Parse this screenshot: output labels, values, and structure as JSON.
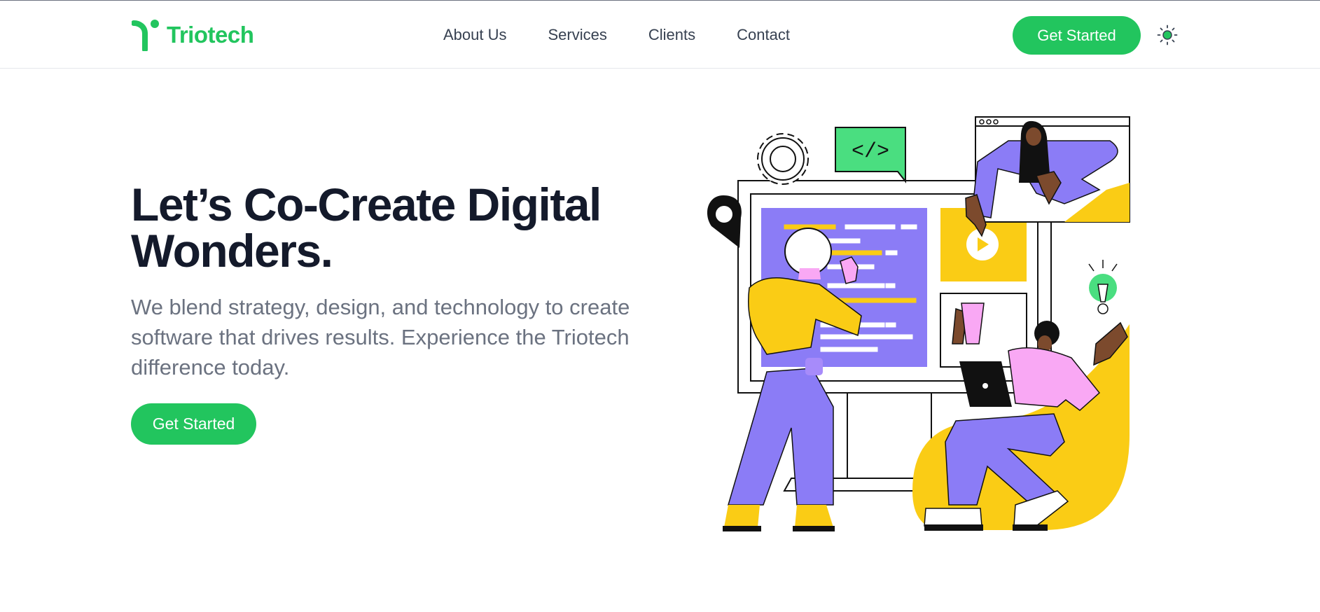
{
  "brand": {
    "name": "Triotech",
    "accent": "#22c55e",
    "logo_icon": "triotech-logo-icon"
  },
  "nav": {
    "items": [
      {
        "label": "About Us"
      },
      {
        "label": "Services"
      },
      {
        "label": "Clients"
      },
      {
        "label": "Contact"
      }
    ]
  },
  "header": {
    "cta_label": "Get Started",
    "theme_icon": "sun-icon"
  },
  "hero": {
    "title": "Let’s Co-Create Digital Wonders.",
    "description": "We blend strategy, design, and technology to create software that drives results. Experience the Triotech difference today.",
    "cta_label": "Get Started"
  },
  "illustration": {
    "code_tag": "</>",
    "colors": {
      "purple": "#8b7cf6",
      "yellow": "#facc15",
      "green": "#4ade80",
      "pink": "#f9a8f4",
      "outline": "#111111"
    }
  }
}
